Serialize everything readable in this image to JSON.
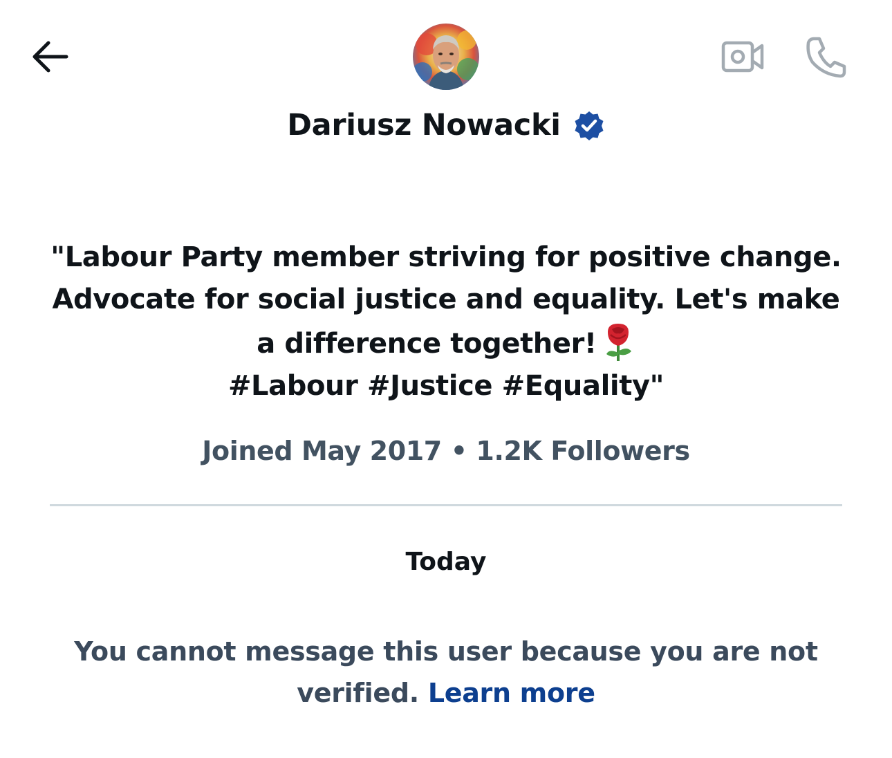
{
  "header": {
    "back_icon": "arrow-left-icon",
    "video_icon": "video-camera-icon",
    "phone_icon": "phone-icon",
    "avatar_alt": "profile-photo"
  },
  "profile": {
    "name": "Dariusz Nowacki",
    "verified_icon": "verified-badge-icon",
    "verified_color": "#1d4fa3",
    "bio_text": "\"Labour Party member striving for positive change. Advocate for social justice and equality. Let's make a difference together!",
    "bio_emoji_icon": "rose-icon",
    "bio_tags": "#Labour #Justice #Equality\"",
    "joined": "Joined May 2017",
    "separator": "•",
    "followers": "1.2K Followers"
  },
  "conversation": {
    "day_label": "Today",
    "notice_text": "You cannot message this user because you are not verified.",
    "notice_link": "Learn more",
    "link_color": "#0d3f8f"
  }
}
